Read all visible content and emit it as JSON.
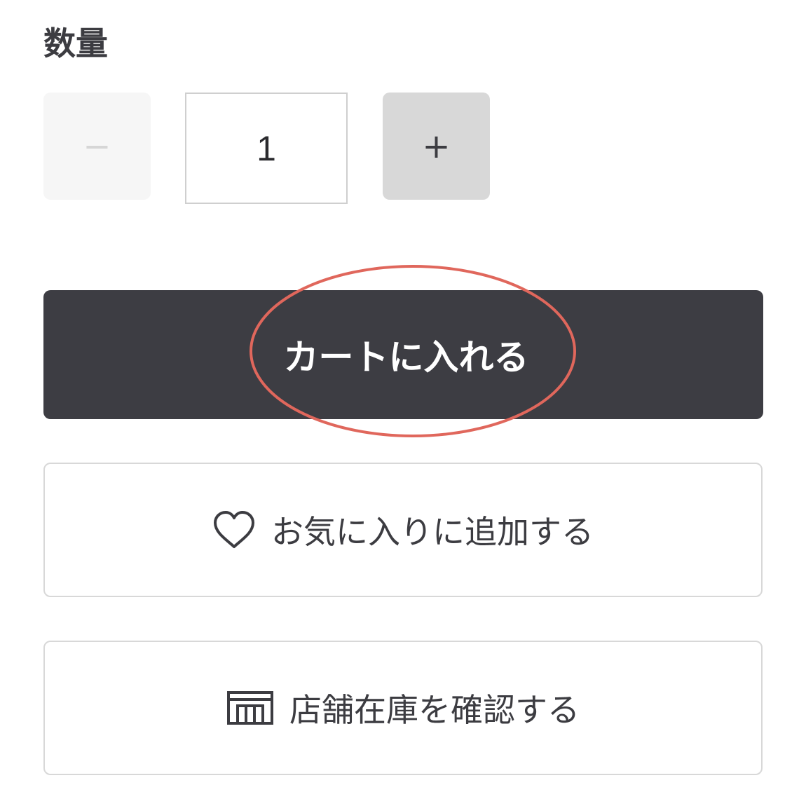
{
  "quantity": {
    "label": "数量",
    "minus_symbol": "−",
    "value": "1",
    "plus_symbol": "+"
  },
  "actions": {
    "cart_label": "カートに入れる",
    "favorite_label": "お気に入りに追加する",
    "store_stock_label": "店舗在庫を確認する"
  },
  "icons": {
    "favorite": "heart-icon",
    "store": "store-icon"
  },
  "colors": {
    "primary_button": "#3d3d43",
    "highlight_circle": "#e0675c",
    "border": "#d8d8d8"
  }
}
